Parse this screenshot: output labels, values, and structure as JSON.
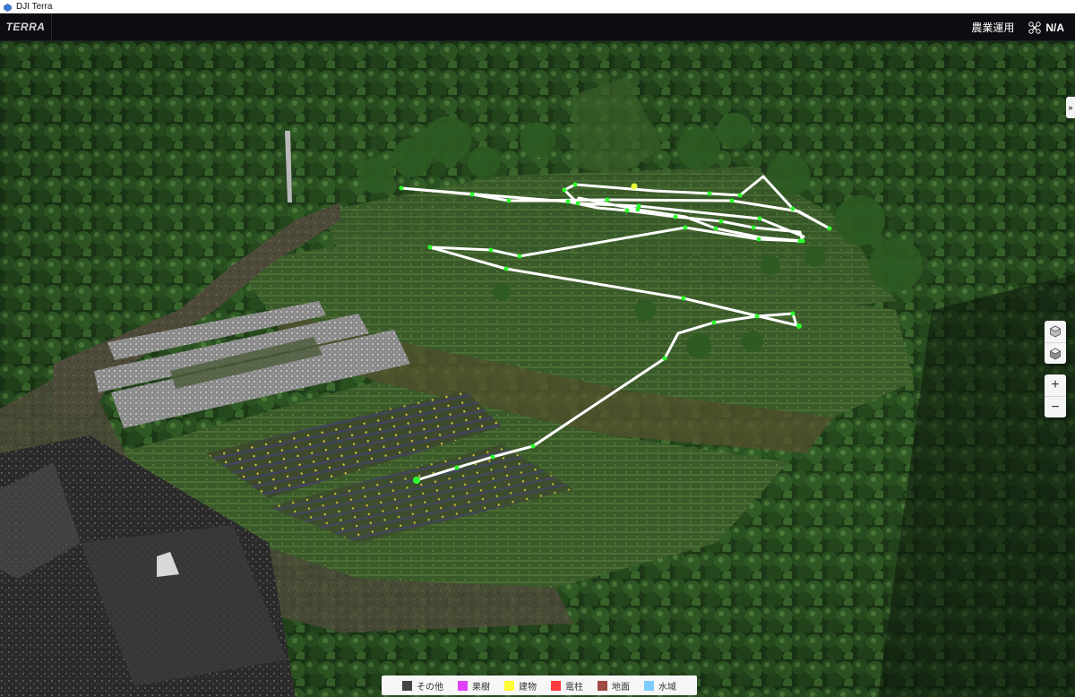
{
  "window": {
    "title": "DJI Terra"
  },
  "header": {
    "logo": "TERRA",
    "mode_label": "農業運用",
    "drone_label": "N/A"
  },
  "controls": {
    "collapse_icon": "double-chevron-right-icon",
    "zoom_in": "+",
    "zoom_out": "−"
  },
  "legend": [
    {
      "label": "その他",
      "color": "#444444"
    },
    {
      "label": "果樹",
      "color": "#e040fb"
    },
    {
      "label": "建物",
      "color": "#ffff33"
    },
    {
      "label": "電柱",
      "color": "#ff3b3b"
    },
    {
      "label": "地面",
      "color": "#a04a44"
    },
    {
      "label": "水域",
      "color": "#7ecbff"
    }
  ],
  "colors": {
    "route": "#ffffff",
    "waypoint": "#2bff2b",
    "start_waypoint": "#e8ff3a"
  }
}
